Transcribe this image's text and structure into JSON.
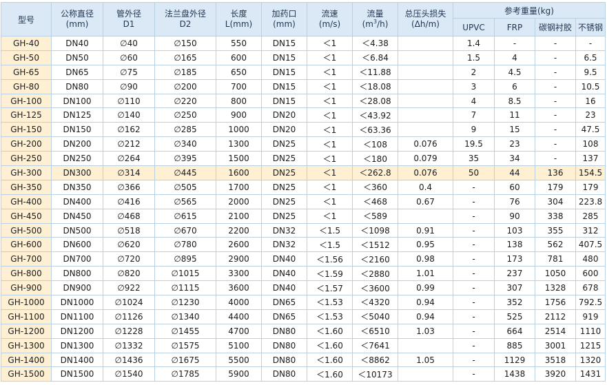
{
  "header": {
    "model": "型号",
    "nominal_dia": [
      "公称直径",
      "(mm)"
    ],
    "pipe_od": [
      "管外径",
      "D1"
    ],
    "flange_od": [
      "法兰盘外径",
      "D2"
    ],
    "length": [
      "长度",
      "L(mm)"
    ],
    "dosing_port": [
      "加药口",
      "(mm)"
    ],
    "velocity": [
      "流速",
      "(m/s)"
    ],
    "flow": [
      "流量",
      "(m",
      "3",
      "/h)"
    ],
    "head_loss": [
      "总压头损失",
      "(Δh/m)"
    ],
    "weight_group": "参考重量(kg)",
    "weights": [
      "UPVC",
      "FRP",
      "碳钢衬胶",
      "不锈钢"
    ]
  },
  "highlight_row": 9,
  "rows": [
    [
      "GH-40",
      "DN40",
      "∅40",
      "∅150",
      "550",
      "DN15",
      "＜1",
      "＜4.38",
      "",
      "1.4",
      "-",
      "-",
      "-"
    ],
    [
      "GH-50",
      "DN50",
      "∅60",
      "∅165",
      "600",
      "DN15",
      "＜1",
      "＜6.84",
      "",
      "1.5",
      "4",
      "-",
      "6.5"
    ],
    [
      "GH-65",
      "DN65",
      "∅75",
      "∅185",
      "650",
      "DN15",
      "＜1",
      "＜11.88",
      "",
      "2",
      "4.5",
      "-",
      "9.5"
    ],
    [
      "GH-80",
      "DN80",
      "∅90",
      "∅200",
      "700",
      "DN15",
      "＜1",
      "＜18.08",
      "",
      "3",
      "6",
      "-",
      "10.5"
    ],
    [
      "GH-100",
      "DN100",
      "∅110",
      "∅220",
      "800",
      "DN15",
      "＜1",
      "＜28.08",
      "",
      "4",
      "8.5",
      "-",
      "16"
    ],
    [
      "GH-125",
      "DN125",
      "∅140",
      "∅250",
      "900",
      "DN20",
      "＜1",
      "＜43.92",
      "",
      "7",
      "11",
      "-",
      "23"
    ],
    [
      "GH-150",
      "DN150",
      "∅162",
      "∅285",
      "1000",
      "DN20",
      "＜1",
      "＜63.36",
      "",
      "9",
      "15",
      "-",
      "47.5"
    ],
    [
      "GH-200",
      "DN200",
      "∅212",
      "∅340",
      "1300",
      "DN25",
      "＜1",
      "＜108",
      "0.076",
      "19.5",
      "23",
      "-",
      "108"
    ],
    [
      "GH-250",
      "DN250",
      "∅264",
      "∅395",
      "1500",
      "DN25",
      "＜1",
      "＜180",
      "0.079",
      "35",
      "34",
      "-",
      "137"
    ],
    [
      "GH-300",
      "DN300",
      "∅314",
      "∅445",
      "1600",
      "DN25",
      "＜1",
      "＜262.8",
      "0.076",
      "50",
      "44",
      "136",
      "154.5"
    ],
    [
      "GH-350",
      "DN350",
      "∅366",
      "∅505",
      "1700",
      "DN25",
      "＜1",
      "＜360",
      "0.4",
      "-",
      "60",
      "179",
      "179"
    ],
    [
      "GH-400",
      "DN400",
      "∅416",
      "∅565",
      "2000",
      "DN25",
      "＜1",
      "＜468",
      "0.67",
      "-",
      "76",
      "304",
      "223.8"
    ],
    [
      "GH-450",
      "DN450",
      "∅468",
      "∅615",
      "2100",
      "DN25",
      "＜1",
      "＜589",
      "",
      "-",
      "90",
      "338",
      "285"
    ],
    [
      "GH-500",
      "DN500",
      "∅518",
      "∅670",
      "2200",
      "DN32",
      "＜1.5",
      "＜1098",
      "0.91",
      "-",
      "103",
      "355",
      "312"
    ],
    [
      "GH-600",
      "DN600",
      "∅620",
      "∅780",
      "2600",
      "DN32",
      "＜1.5",
      "＜1512",
      "0.95",
      "-",
      "138",
      "562",
      "407.5"
    ],
    [
      "GH-700",
      "DN700",
      "∅720",
      "∅895",
      "2900",
      "DN40",
      "＜1.56",
      "＜2160",
      "0.98",
      "-",
      "173",
      "781",
      "480"
    ],
    [
      "GH-800",
      "DN800",
      "∅820",
      "∅1015",
      "3300",
      "DN40",
      "＜1.59",
      "＜2880",
      "1.01",
      "-",
      "237",
      "1050",
      "600"
    ],
    [
      "GH-900",
      "DN900",
      "∅922",
      "∅1115",
      "3600",
      "DN40",
      "＜1.57",
      "＜3600",
      "0.99",
      "-",
      "307",
      "1328",
      "678"
    ],
    [
      "GH-1000",
      "DN1000",
      "∅1024",
      "∅1230",
      "4000",
      "DN65",
      "＜1.53",
      "＜4320",
      "0.94",
      "-",
      "352",
      "1756",
      "792.5"
    ],
    [
      "GH-1100",
      "DN1100",
      "∅1126",
      "∅1340",
      "4400",
      "DN65",
      "＜1.53",
      "＜5040",
      "0.94",
      "-",
      "525",
      "2112",
      "919"
    ],
    [
      "GH-1200",
      "DN1200",
      "∅1228",
      "∅1455",
      "4700",
      "DN80",
      "＜1.60",
      "＜6510",
      "1.03",
      "-",
      "664",
      "2514",
      "1110"
    ],
    [
      "GH-1300",
      "DN1300",
      "∅1332",
      "∅1575",
      "5100",
      "DN80",
      "＜1.60",
      "＜7641",
      "",
      "-",
      "885",
      "3001",
      "1215"
    ],
    [
      "GH-1400",
      "DN1400",
      "∅1436",
      "∅1675",
      "5500",
      "DN80",
      "＜1.60",
      "＜8862",
      "1.05",
      "-",
      "1129",
      "3518",
      "1320"
    ],
    [
      "GH-1500",
      "DN1500",
      "∅1540",
      "∅1785",
      "5900",
      "DN80",
      "＜1.60",
      "＜10173",
      "",
      "-",
      "1438",
      "3920",
      "1431"
    ]
  ]
}
